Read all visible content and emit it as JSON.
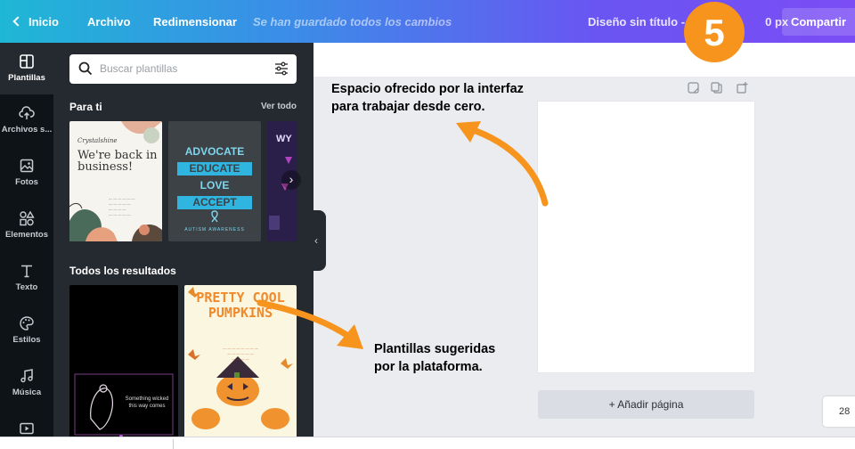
{
  "topbar": {
    "back_label": "Inicio",
    "file_label": "Archivo",
    "resize_label": "Redimensionar",
    "saved_status": "Se han guardado todos los cambios",
    "doc_title": "Diseño sin título - 10",
    "doc_title_suffix": "0 px",
    "share_label": "Compartir"
  },
  "step_badge": "5",
  "sidebar": {
    "items": [
      {
        "label": "Plantillas",
        "icon": "layout-icon"
      },
      {
        "label": "Archivos s...",
        "icon": "cloud-upload-icon"
      },
      {
        "label": "Fotos",
        "icon": "photo-icon"
      },
      {
        "label": "Elementos",
        "icon": "shapes-icon"
      },
      {
        "label": "Texto",
        "icon": "text-icon"
      },
      {
        "label": "Estilos",
        "icon": "palette-icon"
      },
      {
        "label": "Música",
        "icon": "music-note-icon"
      },
      {
        "label": "",
        "icon": "video-icon"
      }
    ]
  },
  "panel": {
    "search_placeholder": "Buscar plantillas",
    "section_for_you": "Para ti",
    "see_all": "Ver todo",
    "section_all_results": "Todos los resultados",
    "templates_for_you": [
      {
        "script": "Crystalshine",
        "headline": "We're back in business!"
      },
      {
        "lines": [
          "ADVOCATE",
          "EDUCATE",
          "LOVE",
          "ACCEPT"
        ],
        "footer": "AUTISM AWARENESS"
      },
      {
        "headline": "WY"
      }
    ],
    "templates_results": [
      {
        "text": "Something wicked this way comes"
      },
      {
        "headline": "PRETTY COOL PUMPKINS"
      }
    ]
  },
  "workspace": {
    "add_page_label": "+ Añadir página",
    "zoom_value": "28"
  },
  "annotations": {
    "workspace_note": [
      "Espacio ofrecido por la interfaz",
      "para trabajar desde cero."
    ],
    "templates_note": [
      "Plantillas sugeridas",
      "por la plataforma."
    ]
  },
  "colors": {
    "accent_orange": "#f7941e",
    "panel_bg": "#252a31",
    "rail_bg": "#0e1318",
    "workspace_bg": "#ebecf0"
  }
}
